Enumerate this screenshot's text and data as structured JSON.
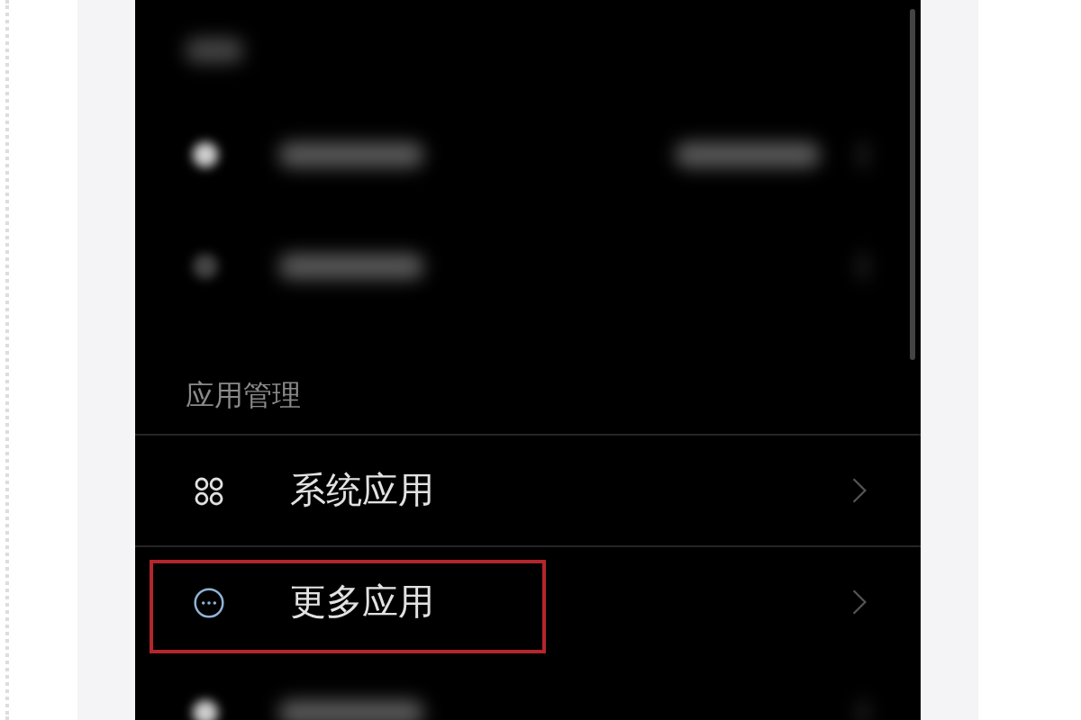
{
  "screen": {
    "items": [
      {
        "kind": "blurred-header"
      },
      {
        "kind": "blurred-row",
        "bright_icon": true,
        "has_value": true
      },
      {
        "kind": "blurred-row",
        "bright_icon": false,
        "has_value": false
      },
      {
        "kind": "header",
        "label": "应用管理"
      },
      {
        "kind": "grid-row",
        "label": "系统应用",
        "highlighted": false
      },
      {
        "kind": "more-row",
        "label": "更多应用",
        "highlighted": true
      },
      {
        "kind": "blurred-row",
        "bright_icon": true,
        "has_value": false
      }
    ]
  }
}
